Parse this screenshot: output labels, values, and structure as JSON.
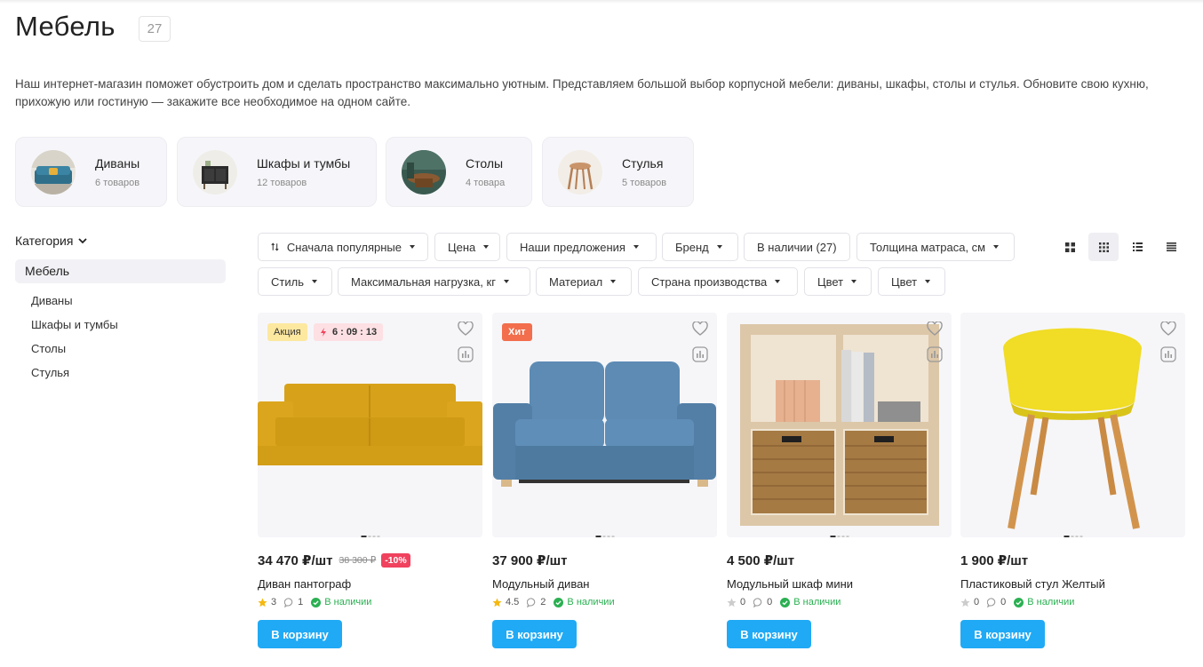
{
  "page": {
    "title": "Мебель",
    "count": "27",
    "description": "Наш интернет-магазин поможет обустроить дом и сделать пространство максимально уютным. Представляем большой выбор корпусной мебели: диваны, шкафы, столы и стулья. Обновите свою кухню, прихожую или гостиную — закажите все необходимое на одном сайте."
  },
  "categories": [
    {
      "name": "Диваны",
      "count": "6 товаров"
    },
    {
      "name": "Шкафы и тумбы",
      "count": "12 товаров"
    },
    {
      "name": "Столы",
      "count": "4 товара"
    },
    {
      "name": "Стулья",
      "count": "5 товаров"
    }
  ],
  "sidebar": {
    "heading": "Категория",
    "active": "Мебель",
    "items": [
      "Диваны",
      "Шкафы и тумбы",
      "Столы",
      "Стулья"
    ]
  },
  "filters": {
    "row1": [
      "Сначала популярные",
      "Цена",
      "Наши предложения",
      "Бренд",
      "В наличии (27)",
      "Толщина матраса, см"
    ],
    "row2": [
      "Стиль",
      "Максимальная нагрузка, кг",
      "Материал",
      "Страна производства",
      "Цвет",
      "Цвет"
    ]
  },
  "view_modes": [
    "grid-large-icon",
    "grid-small-icon",
    "list-icon",
    "table-icon"
  ],
  "products": [
    {
      "name": "Диван пантограф",
      "price": "34 470 ₽/шт",
      "old_price": "38 300 ₽",
      "discount": "-10%",
      "badge_sale": "Акция",
      "timer": "6 : 09 : 13",
      "rating": "3",
      "reviews": "1",
      "stock": "В наличии",
      "cart": "В корзину"
    },
    {
      "name": "Модульный диван",
      "price": "37 900 ₽/шт",
      "badge_hit": "Хит",
      "rating": "4.5",
      "reviews": "2",
      "stock": "В наличии",
      "cart": "В корзину"
    },
    {
      "name": "Модульный шкаф мини",
      "price": "4 500 ₽/шт",
      "rating": "0",
      "reviews": "0",
      "stock": "В наличии",
      "cart": "В корзину"
    },
    {
      "name": "Пластиковый стул Желтый",
      "price": "1 900 ₽/шт",
      "rating": "0",
      "reviews": "0",
      "stock": "В наличии",
      "cart": "В корзину"
    }
  ],
  "colors": {
    "accent": "#20aaf5",
    "stock_green": "#2bb052",
    "discount_red": "#f0425e",
    "hit_badge": "#f26e4c",
    "sale_badge": "#fde8a0",
    "star": "#f5b80f"
  }
}
